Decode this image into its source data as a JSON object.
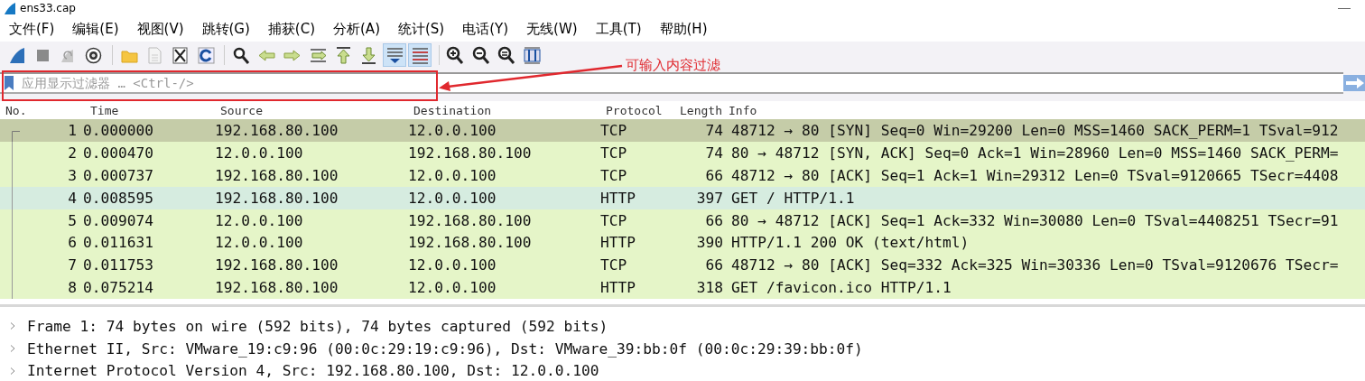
{
  "window": {
    "title": "ens33.cap"
  },
  "menu": [
    "文件(F)",
    "编辑(E)",
    "视图(V)",
    "跳转(G)",
    "捕获(C)",
    "分析(A)",
    "统计(S)",
    "电话(Y)",
    "无线(W)",
    "工具(T)",
    "帮助(H)"
  ],
  "toolbar": [
    {
      "pressed": false
    },
    {
      "pressed": false
    },
    {
      "pressed": false
    },
    {
      "pressed": false
    },
    {
      "pressed": false
    },
    {
      "pressed": false
    },
    {
      "pressed": false
    },
    {
      "pressed": false
    },
    {
      "pressed": false
    },
    {
      "pressed": false
    },
    {
      "pressed": false
    },
    {
      "pressed": false
    },
    {
      "pressed": false
    },
    {
      "pressed": false
    },
    {
      "pressed": true
    },
    {
      "pressed": true
    },
    {
      "pressed": false
    },
    {
      "pressed": false
    },
    {
      "pressed": false
    },
    {
      "pressed": false
    }
  ],
  "filter": {
    "placeholder": "应用显示过滤器 … <Ctrl-/>"
  },
  "annotation": {
    "text": "可输入内容过滤"
  },
  "table": {
    "columns": [
      "No.",
      "Time",
      "Source",
      "Destination",
      "Protocol",
      "Length",
      "Info"
    ],
    "rows": [
      {
        "no": "1",
        "time": "0.000000",
        "source": "192.168.80.100",
        "destination": "12.0.0.100",
        "protocol": "TCP",
        "length": "74",
        "info": "48712 → 80 [SYN] Seq=0 Win=29200 Len=0 MSS=1460 SACK_PERM=1 TSval=912",
        "selected": true,
        "hovered": false
      },
      {
        "no": "2",
        "time": "0.000470",
        "source": "12.0.0.100",
        "destination": "192.168.80.100",
        "protocol": "TCP",
        "length": "74",
        "info": "80 → 48712 [SYN, ACK] Seq=0 Ack=1 Win=28960 Len=0 MSS=1460 SACK_PERM=",
        "selected": false,
        "hovered": false
      },
      {
        "no": "3",
        "time": "0.000737",
        "source": "192.168.80.100",
        "destination": "12.0.0.100",
        "protocol": "TCP",
        "length": "66",
        "info": "48712 → 80 [ACK] Seq=1 Ack=1 Win=29312 Len=0 TSval=9120665 TSecr=4408",
        "selected": false,
        "hovered": false
      },
      {
        "no": "4",
        "time": "0.008595",
        "source": "192.168.80.100",
        "destination": "12.0.0.100",
        "protocol": "HTTP",
        "length": "397",
        "info": "GET / HTTP/1.1",
        "selected": false,
        "hovered": true
      },
      {
        "no": "5",
        "time": "0.009074",
        "source": "12.0.0.100",
        "destination": "192.168.80.100",
        "protocol": "TCP",
        "length": "66",
        "info": "80 → 48712 [ACK] Seq=1 Ack=332 Win=30080 Len=0 TSval=4408251 TSecr=91",
        "selected": false,
        "hovered": false
      },
      {
        "no": "6",
        "time": "0.011631",
        "source": "12.0.0.100",
        "destination": "192.168.80.100",
        "protocol": "HTTP",
        "length": "390",
        "info": "HTTP/1.1 200 OK  (text/html)",
        "selected": false,
        "hovered": false
      },
      {
        "no": "7",
        "time": "0.011753",
        "source": "192.168.80.100",
        "destination": "12.0.0.100",
        "protocol": "TCP",
        "length": "66",
        "info": "48712 → 80 [ACK] Seq=332 Ack=325 Win=30336 Len=0 TSval=9120676 TSecr=",
        "selected": false,
        "hovered": false
      },
      {
        "no": "8",
        "time": "0.075214",
        "source": "192.168.80.100",
        "destination": "12.0.0.100",
        "protocol": "HTTP",
        "length": "318",
        "info": "GET /favicon.ico HTTP/1.1",
        "selected": false,
        "hovered": false
      }
    ]
  },
  "details": [
    {
      "text": "Frame 1: 74 bytes on wire (592 bits), 74 bytes captured (592 bits)",
      "expanded": false
    },
    {
      "text": "Ethernet II, Src: VMware_19:c9:96 (00:0c:29:19:c9:96), Dst: VMware_39:bb:0f (00:0c:29:39:bb:0f)",
      "expanded": false
    },
    {
      "text": "Internet Protocol Version 4, Src: 192.168.80.100, Dst: 12.0.0.100",
      "expanded": false
    }
  ]
}
